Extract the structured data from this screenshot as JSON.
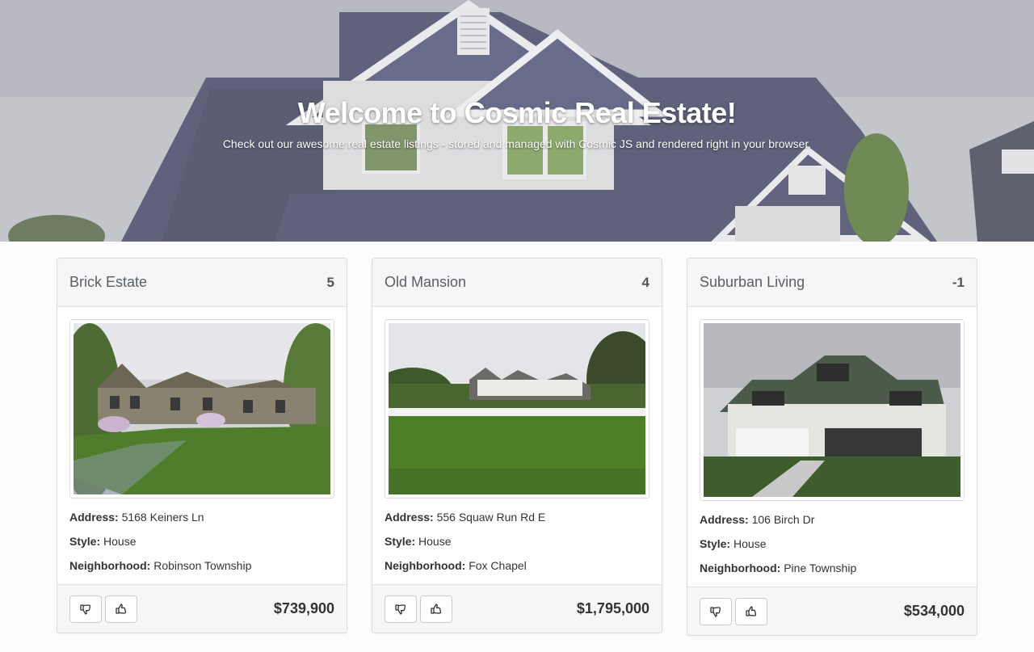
{
  "hero": {
    "title": "Welcome to Cosmic Real Estate!",
    "subtitle": "Check out our awesome real estate listings - stored and managed with Cosmic JS and rendered right in your browser."
  },
  "labels": {
    "address": "Address:",
    "style": "Style:",
    "neighborhood": "Neighborhood:"
  },
  "listings": [
    {
      "title": "Brick Estate",
      "score": "5",
      "address": "5168 Keiners Ln",
      "style": "House",
      "neighborhood": "Robinson Township",
      "price": "$739,900"
    },
    {
      "title": "Old Mansion",
      "score": "4",
      "address": "556 Squaw Run Rd E",
      "style": "House",
      "neighborhood": "Fox Chapel",
      "price": "$1,795,000"
    },
    {
      "title": "Suburban Living",
      "score": "-1",
      "address": "106 Birch Dr",
      "style": "House",
      "neighborhood": "Pine Township",
      "price": "$534,000"
    }
  ],
  "icons": {
    "downvote": "thumbs-down-icon",
    "upvote": "thumbs-up-icon"
  }
}
